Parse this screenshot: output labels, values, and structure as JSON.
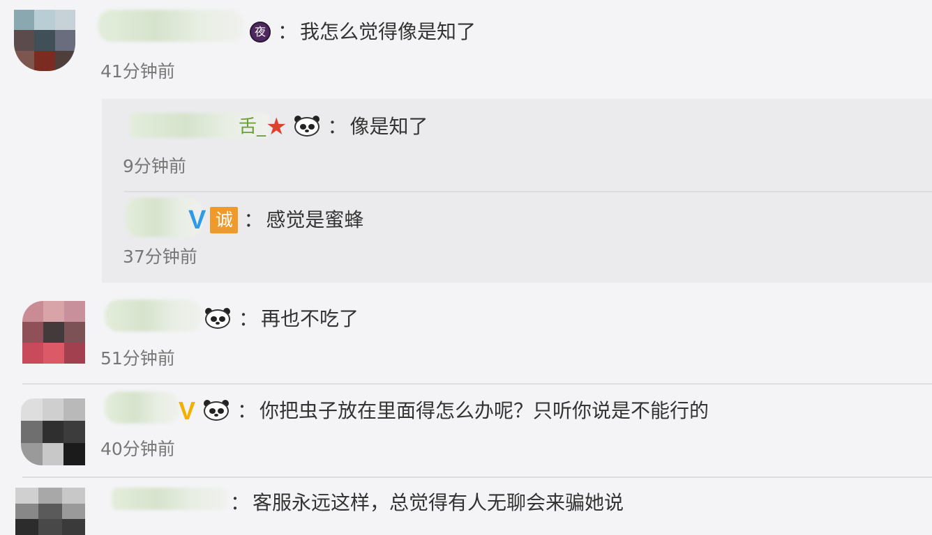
{
  "comments": [
    {
      "name_suffix": "",
      "text": "我怎么觉得像是知了",
      "time": "41分钟前",
      "badges": [
        "night-badge-icon"
      ]
    },
    {
      "name_suffix": "",
      "text": "再也不吃了",
      "time": "51分钟前",
      "badges": [
        "panda-icon"
      ]
    },
    {
      "name_suffix": "",
      "text": "你把虫子放在里面得怎么办呢？只听你说是不能行的",
      "time": "40分钟前",
      "badges": [
        "gold-v-icon",
        "panda-icon"
      ]
    },
    {
      "name_suffix": "",
      "text": "客服永远这样，总觉得有人无聊会来骗她说",
      "time": "",
      "badges": []
    }
  ],
  "replies": [
    {
      "name_suffix": "舌_",
      "text": "像是知了",
      "time": "9分钟前",
      "badges": [
        "star-icon",
        "panda-icon"
      ]
    },
    {
      "name_suffix": "",
      "text": "感觉是蜜蜂",
      "time": "37分钟前",
      "badges": [
        "blue-v-icon",
        "cheng-badge-icon"
      ]
    }
  ],
  "labels": {
    "colon": "：",
    "night_badge": "夜",
    "blue_v": "V",
    "gold_v": "V",
    "cheng_badge": "诚",
    "star": "★"
  },
  "colors": {
    "background": "#f4f4f6",
    "reply_background": "#ebebed",
    "time_text": "#777777",
    "blue_v": "#2f9be6",
    "gold_v": "#f4b000",
    "cheng_badge": "#ef9a2c",
    "star": "#e0412c",
    "night_badge": "#4d2a5e"
  }
}
